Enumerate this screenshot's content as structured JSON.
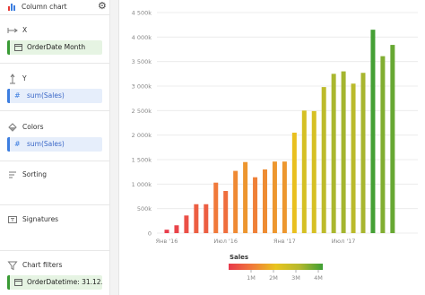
{
  "sidebar": {
    "title": "Column chart",
    "sections": {
      "x": {
        "label": "X",
        "field": "OrderDate Month"
      },
      "y": {
        "label": "Y",
        "field": "sum(Sales)"
      },
      "colors": {
        "label": "Colors",
        "field": "sum(Sales)"
      },
      "sorting": {
        "label": "Sorting"
      },
      "signatures": {
        "label": "Signatures"
      },
      "filters": {
        "label": "Chart filters",
        "field": "OrderDatetime: 31.12.20..."
      }
    }
  },
  "chart_data": {
    "type": "bar",
    "y_ticks": [
      "0",
      "500k",
      "1 000k",
      "1 500k",
      "2 000k",
      "2 500k",
      "3 000k",
      "3 500k",
      "4 000k",
      "4 500k"
    ],
    "ylim": [
      0,
      4500000
    ],
    "x_ticks": [
      {
        "label": "Янв '16",
        "index": 0
      },
      {
        "label": "Июл '16",
        "index": 6
      },
      {
        "label": "Янв '17",
        "index": 12
      },
      {
        "label": "Июл '17",
        "index": 18
      }
    ],
    "categories": [
      "Jan '16",
      "Feb '16",
      "Mar '16",
      "Apr '16",
      "May '16",
      "Jun '16",
      "Jul '16",
      "Aug '16",
      "Sep '16",
      "Oct '16",
      "Nov '16",
      "Dec '16",
      "Jan '17",
      "Feb '17",
      "Mar '17",
      "Apr '17",
      "May '17",
      "Jun '17",
      "Jul '17",
      "Aug '17",
      "Sep '17",
      "Oct '17",
      "Nov '17",
      "Dec '17"
    ],
    "values": [
      70000,
      160000,
      360000,
      590000,
      590000,
      1030000,
      860000,
      1270000,
      1450000,
      1140000,
      1300000,
      1460000,
      1460000,
      2050000,
      2500000,
      2490000,
      2980000,
      3250000,
      3300000,
      3050000,
      3270000,
      4150000,
      3610000,
      3840000
    ],
    "legend": {
      "title": "Sales",
      "ticks": [
        "1M",
        "2M",
        "3M",
        "4M"
      ],
      "range": [
        0,
        4200000
      ],
      "gradient_colors": [
        "#e8394c",
        "#f07a3a",
        "#e9c41e",
        "#b5b92e",
        "#3f9f35"
      ]
    },
    "grid": true
  }
}
